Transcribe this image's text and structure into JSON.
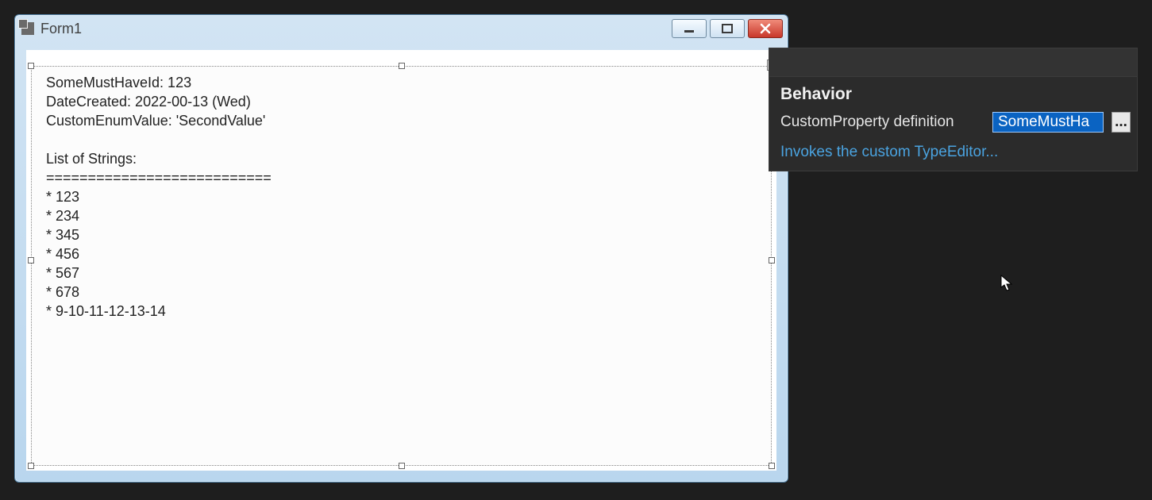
{
  "window": {
    "title": "Form1",
    "content_lines": [
      "SomeMustHaveId: 123",
      "DateCreated: 2022-00-13 (Wed)",
      "CustomEnumValue: 'SecondValue'",
      "",
      "List of Strings:",
      "===========================",
      "* 123",
      "* 234",
      "* 345",
      "* 456",
      "* 567",
      "* 678",
      "* 9-10-11-12-13-14"
    ]
  },
  "property_panel": {
    "category": "Behavior",
    "label": "CustomProperty definition",
    "value_display": "SomeMustHa",
    "ellipsis": "...",
    "description": "Invokes the custom TypeEditor..."
  }
}
